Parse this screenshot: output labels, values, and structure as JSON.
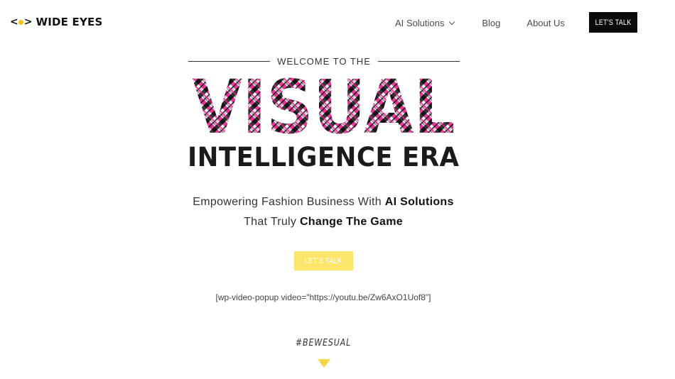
{
  "header": {
    "logo_mark": "<o>",
    "logo_text": "WIDE EYES",
    "nav": [
      {
        "label": "AI Solutions",
        "has_dropdown": true
      },
      {
        "label": "Blog"
      },
      {
        "label": "About Us"
      }
    ],
    "cta_label": "LET'S TALK"
  },
  "hero": {
    "welcome": "WELCOME TO THE",
    "visual_word": "VISUAL",
    "title": "INTELLIGENCE ERA",
    "tagline_1_plain": "Empowering Fashion Business With ",
    "tagline_1_bold": "AI Solutions",
    "tagline_2_plain": "That Truly ",
    "tagline_2_bold": "Change The Game",
    "cta_label": "LET'S TALK",
    "shortcode": "[wp-video-popup video=\"https://youtu.be/Zw6AxO1Uof8\"]",
    "hashtag": "#BEWESUAL"
  },
  "colors": {
    "accent_yellow": "#fce56a",
    "arrow_yellow": "#f6d54a",
    "plaid_pink": "#e8198a",
    "plaid_black": "#141414",
    "cta_dark": "#0b0b0b"
  },
  "icons": {
    "logo": "eye-logo-icon",
    "dropdown": "chevron-down-icon",
    "scroll": "triangle-down-icon"
  }
}
